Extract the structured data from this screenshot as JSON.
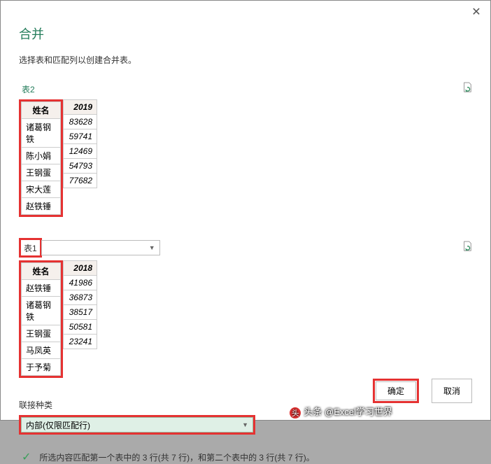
{
  "window": {
    "title": "合并",
    "subtitle": "选择表和匹配列以创建合并表。"
  },
  "table2": {
    "label": "表2",
    "header_name": "姓名",
    "header_year": "2019",
    "rows": [
      {
        "name": "诸葛钢铁",
        "val": "83628"
      },
      {
        "name": "陈小娟",
        "val": "59741"
      },
      {
        "name": "王钢蛋",
        "val": "12469"
      },
      {
        "name": "宋大莲",
        "val": "54793"
      },
      {
        "name": "赵铁锤",
        "val": "77682"
      }
    ]
  },
  "table1": {
    "label": "表1",
    "header_name": "姓名",
    "header_year": "2018",
    "rows": [
      {
        "name": "赵铁锤",
        "val": "41986"
      },
      {
        "name": "诸葛钢铁",
        "val": "36873"
      },
      {
        "name": "王钢蛋",
        "val": "38517"
      },
      {
        "name": "马凤英",
        "val": "50581"
      },
      {
        "name": "于予菊",
        "val": "23241"
      }
    ]
  },
  "join": {
    "label": "联接种类",
    "selected": "内部(仅限匹配行)"
  },
  "status": "所选内容匹配第一个表中的 3 行(共 7 行)，和第二个表中的 3 行(共 7 行)。",
  "buttons": {
    "ok": "确定",
    "cancel": "取消"
  },
  "watermark": "头条 @Excel学习世界"
}
